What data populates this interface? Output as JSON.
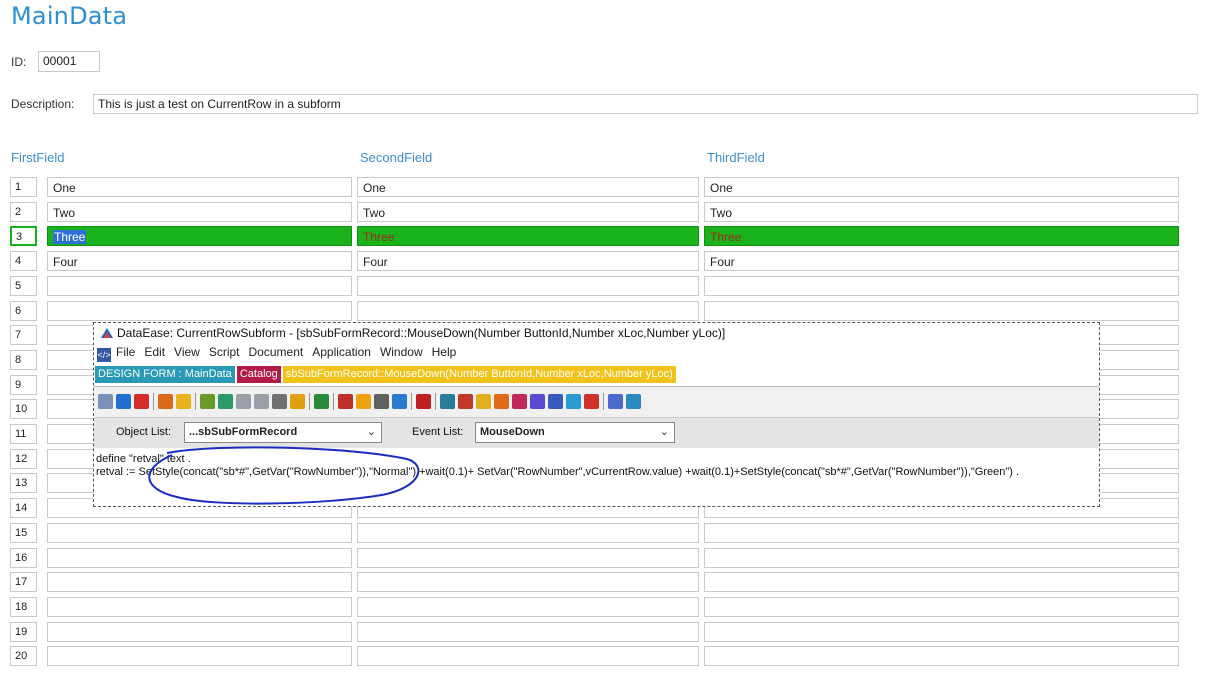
{
  "form": {
    "title": "MainData",
    "id_label": "ID:",
    "id_value": "00001",
    "description_label": "Description:",
    "description_value": "This is just a test on CurrentRow in a subform"
  },
  "table": {
    "columns": [
      "FirstField",
      "SecondField",
      "ThirdField"
    ],
    "rows": [
      {
        "num": "1",
        "first": "One",
        "second": "One",
        "third": "One"
      },
      {
        "num": "2",
        "first": "Two",
        "second": "Two",
        "third": "Two"
      },
      {
        "num": "3",
        "first": "Three",
        "second": "Three",
        "third": "Three",
        "selected": true
      },
      {
        "num": "4",
        "first": "Four",
        "second": "Four",
        "third": "Four"
      },
      {
        "num": "5",
        "first": "",
        "second": "",
        "third": ""
      },
      {
        "num": "6",
        "first": "",
        "second": "",
        "third": ""
      },
      {
        "num": "7",
        "first": "",
        "second": "",
        "third": ""
      },
      {
        "num": "8",
        "first": "",
        "second": "",
        "third": ""
      },
      {
        "num": "9",
        "first": "",
        "second": "",
        "third": ""
      },
      {
        "num": "10",
        "first": "",
        "second": "",
        "third": ""
      },
      {
        "num": "11",
        "first": "",
        "second": "",
        "third": ""
      },
      {
        "num": "12",
        "first": "",
        "second": "",
        "third": ""
      },
      {
        "num": "13",
        "first": "",
        "second": "",
        "third": ""
      },
      {
        "num": "14",
        "first": "",
        "second": "",
        "third": ""
      },
      {
        "num": "15",
        "first": "",
        "second": "",
        "third": ""
      },
      {
        "num": "16",
        "first": "",
        "second": "",
        "third": ""
      },
      {
        "num": "17",
        "first": "",
        "second": "",
        "third": ""
      },
      {
        "num": "18",
        "first": "",
        "second": "",
        "third": ""
      },
      {
        "num": "19",
        "first": "",
        "second": "",
        "third": ""
      },
      {
        "num": "20",
        "first": "",
        "second": "",
        "third": ""
      }
    ],
    "selected_color": "#1bb31b"
  },
  "editor": {
    "title": "DataEase: CurrentRowSubform - [sbSubFormRecord::MouseDown(Number ButtonId,Number xLoc,Number yLoc)]",
    "menu": [
      "File",
      "Edit",
      "View",
      "Script",
      "Document",
      "Application",
      "Window",
      "Help"
    ],
    "tabs": [
      {
        "label": "DESIGN FORM : MainData"
      },
      {
        "label": "Catalog"
      },
      {
        "label": "sbSubFormRecord::MouseDown(Number ButtonId,Number xLoc,Number yLoc)"
      }
    ],
    "object_list_label": "Object List:",
    "object_list_value": "...sbSubFormRecord",
    "event_list_label": "Event List:",
    "event_list_value": "MouseDown",
    "code_lines": [
      "define \"retval\" text .",
      "retval := SetStyle(concat(\"sb*#\",GetVar(\"RowNumber\")),\"Normal\") +wait(0.1)+ SetVar(\"RowNumber\",vCurrentRow.value) +wait(0.1)+SetStyle(concat(\"sb*#\",GetVar(\"RowNumber\")),\"Green\") ."
    ],
    "toolbar_icons": [
      "design-icon",
      "arrow-icon",
      "save-icon",
      "gear-icon",
      "cut-icon",
      "copy-icon",
      "paste-icon",
      "undo-icon",
      "redo-icon",
      "stop-icon",
      "back-icon",
      "search-icon",
      "replace-icon",
      "forward-icon",
      "run-icon",
      "window-icon",
      "delete-icon",
      "doc-icon",
      "print-icon",
      "folder-icon",
      "chart-icon",
      "grid-icon",
      "user-icon",
      "disk-icon",
      "tree-icon",
      "relation-icon",
      "settings-icon",
      "export-icon"
    ],
    "accent_tab1": "#2a99b5",
    "accent_tab2": "#b31a46",
    "accent_tab3": "#f1c21a",
    "annotation_color": "#1a2bbf"
  }
}
